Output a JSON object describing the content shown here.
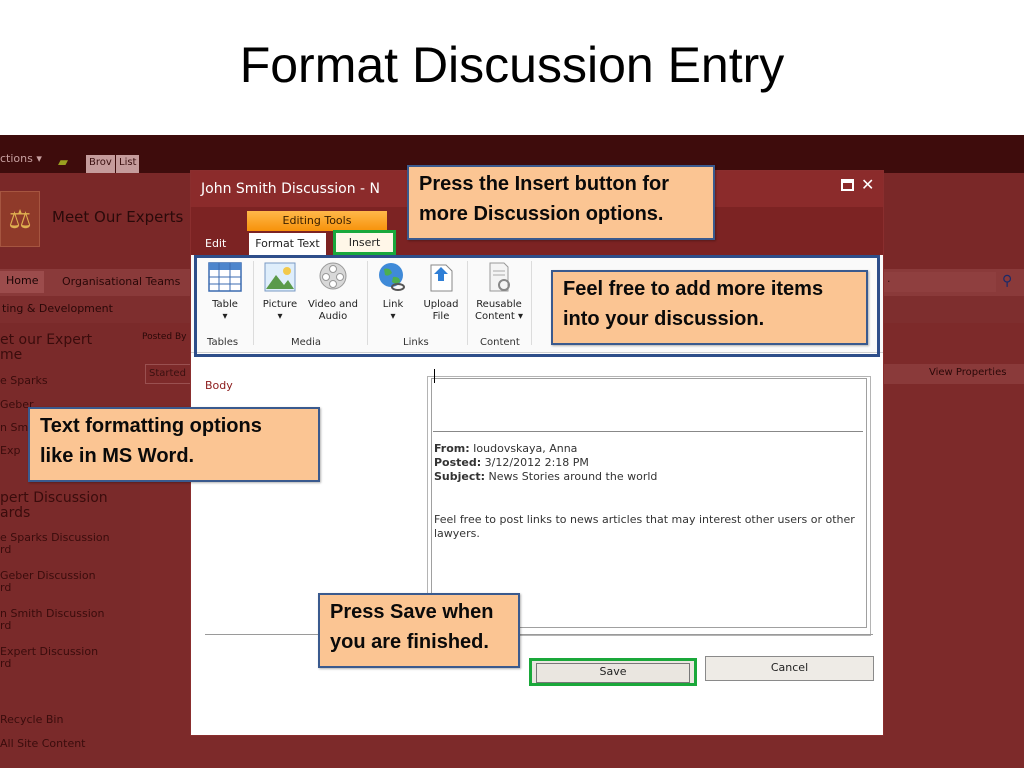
{
  "slide": {
    "title": "Format Discussion Entry"
  },
  "background_page": {
    "actions_label": "ctions ▾",
    "tabs": [
      "Brov",
      "List"
    ],
    "site_title": "Meet Our Experts",
    "nav_home": "Home",
    "nav_teams": "Organisational Teams",
    "breadcrumb": "ting & Development",
    "left_nav": {
      "heading1_line1": "et our Expert",
      "heading1_line2": "me",
      "items1": [
        "e Sparks",
        "Geber",
        "n Sm",
        "Exp"
      ],
      "heading2_line1": "pert Discussion",
      "heading2_line2": "ards",
      "board_items": [
        {
          "line1": "e Sparks Discussion",
          "line2": "rd"
        },
        {
          "line1": "Geber Discussion",
          "line2": "rd"
        },
        {
          "line1": "n Smith Discussion",
          "line2": "rd"
        },
        {
          "line1": "Expert Discussion",
          "line2": "rd"
        }
      ],
      "recycle_bin": "Recycle Bin",
      "all_site_content": "All Site Content"
    },
    "posted_by": "Posted By",
    "started": "Started",
    "view_properties": "View Properties"
  },
  "dialog": {
    "title": "John Smith Discussion - N",
    "contextual_group": "Editing Tools",
    "tabs": {
      "edit": "Edit",
      "format_text": "Format Text",
      "insert": "Insert"
    },
    "ribbon": {
      "buttons": {
        "table": {
          "label": "Table",
          "caret": "▾"
        },
        "picture": {
          "label": "Picture",
          "caret": "▾"
        },
        "video": {
          "line1": "Video and",
          "line2": "Audio"
        },
        "link": {
          "label": "Link",
          "caret": "▾"
        },
        "upload": {
          "line1": "Upload",
          "line2": "File"
        },
        "reusable": {
          "line1": "Reusable",
          "line2": "Content ▾"
        }
      },
      "groups": {
        "tables": "Tables",
        "media": "Media",
        "links": "Links",
        "content": "Content"
      }
    },
    "body_label": "Body",
    "email": {
      "from_label": "From:",
      "from_value": "Ioudovskaya, Anna",
      "posted_label": "Posted:",
      "posted_value": "3/12/2012 2:18 PM",
      "subject_label": "Subject:",
      "subject_value": "News Stories around the world",
      "body": "Feel free to post links to news articles that may interest other users or other lawyers."
    },
    "buttons": {
      "save": "Save",
      "cancel": "Cancel"
    }
  },
  "callouts": {
    "insert": {
      "line1": "Press the Insert button for",
      "line2": "more Discussion options."
    },
    "items": {
      "line1": "Feel free to add more items",
      "line2": "into your discussion."
    },
    "format": {
      "line1": "Text formatting options",
      "line2": "like in MS Word."
    },
    "save": {
      "line1": "Press Save when",
      "line2": "you are finished."
    }
  },
  "colors": {
    "callout_fill": "#fbc593",
    "callout_border": "#3a5a8e",
    "highlight_green": "#19a83c",
    "dialog_header": "#8b2b2b"
  }
}
